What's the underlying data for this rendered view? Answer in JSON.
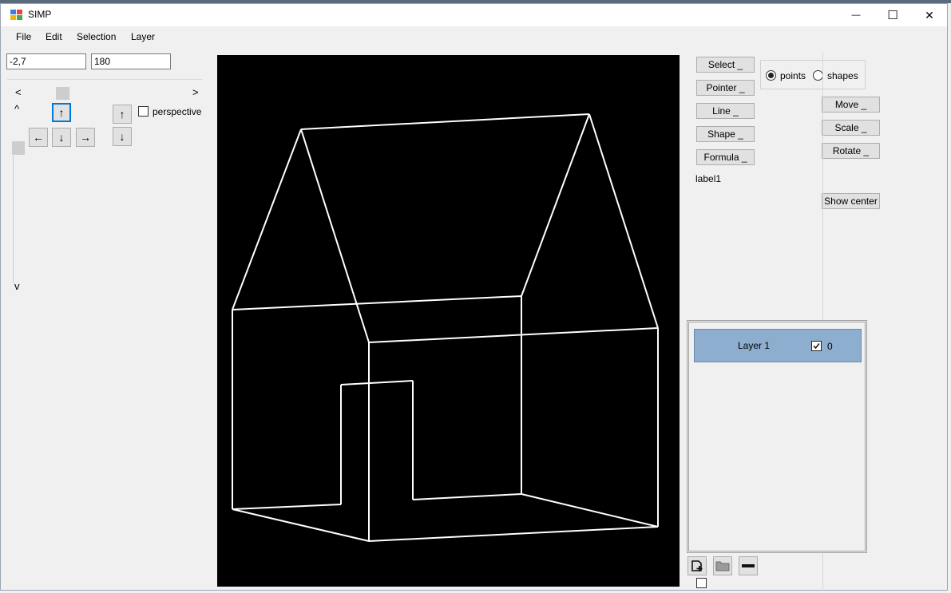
{
  "window": {
    "title": "SIMP",
    "minimize_glyph": "—",
    "maximize_glyph": "☐",
    "close_glyph": "✕"
  },
  "menu": {
    "items": [
      "File",
      "Edit",
      "Selection",
      "Layer"
    ]
  },
  "coords": {
    "x_value": "-2,7",
    "y_value": "180"
  },
  "nav": {
    "hscroll_left": "<",
    "hscroll_right": ">",
    "vscroll_up": "^",
    "vscroll_down": "v",
    "up": "↑",
    "left": "←",
    "down": "↓",
    "right": "→",
    "up2": "↑",
    "down2": "↓",
    "perspective_label": "perspective",
    "perspective_checked": false
  },
  "tools": {
    "select": "Select _",
    "pointer": "Pointer _",
    "line": "Line _",
    "shape": "Shape _",
    "formula": "Formula _",
    "status_label": "label1"
  },
  "mode": {
    "points": "points",
    "shapes": "shapes",
    "selected": "points"
  },
  "transform": {
    "move": "Move _",
    "scale": "Scale _",
    "rotate": "Rotate _",
    "show_center": "Show center"
  },
  "layers": {
    "items": [
      {
        "name": "Layer 1",
        "visible": true,
        "value": "0"
      }
    ],
    "selected_bg": "#8eaed0"
  },
  "colors": {
    "canvas": "#000000",
    "stroke": "#ffffff",
    "accent": "#0078d7"
  },
  "drawing": {
    "lines": [
      [
        376,
        157,
        737,
        138
      ],
      [
        376,
        157,
        290,
        383
      ],
      [
        376,
        157,
        461,
        424
      ],
      [
        737,
        138,
        652,
        366
      ],
      [
        737,
        138,
        823,
        406
      ],
      [
        290,
        383,
        652,
        366
      ],
      [
        461,
        424,
        823,
        406
      ],
      [
        290,
        383,
        290,
        633
      ],
      [
        461,
        424,
        461,
        673
      ],
      [
        652,
        366,
        652,
        614
      ],
      [
        823,
        406,
        823,
        655
      ],
      [
        290,
        633,
        461,
        673
      ],
      [
        461,
        673,
        823,
        655
      ],
      [
        290,
        633,
        426,
        627
      ],
      [
        516,
        621,
        652,
        614
      ],
      [
        652,
        614,
        823,
        655
      ],
      [
        426,
        627,
        426,
        477
      ],
      [
        426,
        477,
        516,
        472
      ],
      [
        516,
        472,
        516,
        621
      ]
    ]
  }
}
